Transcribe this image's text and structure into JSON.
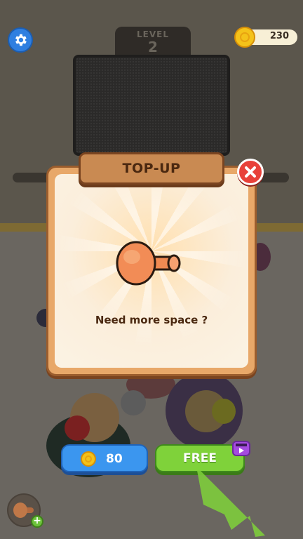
{
  "hud": {
    "level_label": "LEVEL",
    "level_number": "2",
    "coins": "230"
  },
  "dialog": {
    "title": "TOP-UP",
    "message": "Need more space ?",
    "item_icon": "peg-hook-icon"
  },
  "actions": {
    "buy_price": "80",
    "free_label": "FREE",
    "free_badge_icon": "video-ad-icon"
  },
  "colors": {
    "buy_button": "#3b96ef",
    "free_button": "#7fd23a",
    "close_button": "#e8413a",
    "settings_button": "#2f7fe0"
  }
}
